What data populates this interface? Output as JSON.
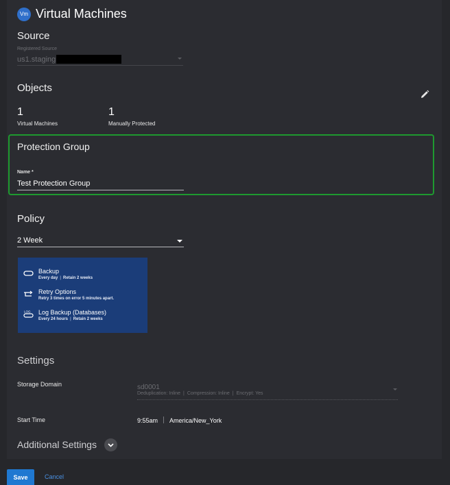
{
  "header": {
    "badge": "Vm",
    "title": "Virtual Machines"
  },
  "source": {
    "heading": "Source",
    "registered_label": "Registered Source",
    "registered_value": "us1.staging"
  },
  "objects": {
    "heading": "Objects",
    "stats": [
      {
        "count": "1",
        "label": "Virtual Machines"
      },
      {
        "count": "1",
        "label": "Manually Protected"
      }
    ]
  },
  "protection_group": {
    "heading": "Protection Group",
    "name_label": "Name *",
    "name_value": "Test Protection Group"
  },
  "policy": {
    "heading": "Policy",
    "selected": "2 Week",
    "items": [
      {
        "icon": "backup-icon",
        "title": "Backup",
        "detail_1": "Every day",
        "detail_2": "Retain 2 weeks"
      },
      {
        "icon": "retry-icon",
        "title": "Retry Options",
        "detail_1": "Retry 3 times on error 5 minutes apart.",
        "detail_2": ""
      },
      {
        "icon": "log-backup-icon",
        "title": "Log Backup (Databases)",
        "detail_1": "Every 24 hours",
        "detail_2": "Retain 2 weeks"
      }
    ]
  },
  "settings": {
    "heading": "Settings",
    "storage_domain_label": "Storage Domain",
    "storage_domain_value": "sd0001",
    "storage_domain_details": [
      "Deduplication: Inline",
      "Compression: Inline",
      "Encrypt: Yes"
    ],
    "start_time_label": "Start Time",
    "start_time": "9:55am",
    "timezone": "America/New_York",
    "additional_heading": "Additional Settings"
  },
  "footer": {
    "save_label": "Save",
    "cancel_label": "Cancel"
  },
  "colors": {
    "accent": "#1f78d1",
    "highlight_border": "#1e9a2f",
    "policy_card": "#1b3d79"
  }
}
